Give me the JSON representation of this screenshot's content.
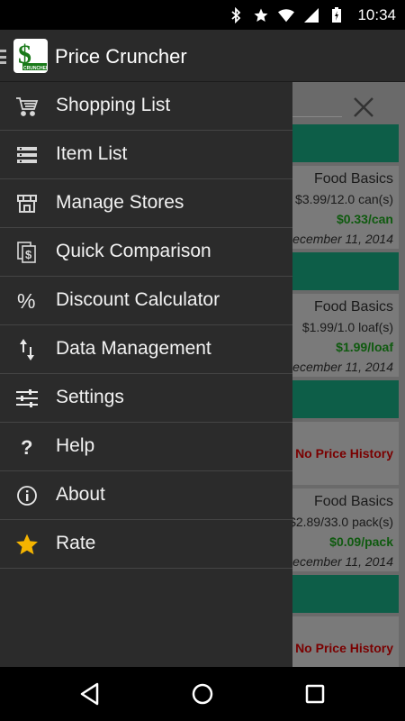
{
  "status_bar": {
    "time": "10:34",
    "icons": [
      "bluetooth-icon",
      "star-icon",
      "wifi-icon",
      "battery-icon"
    ]
  },
  "app_bar": {
    "title": "Price Cruncher",
    "logo_text": "CRUNCHER"
  },
  "drawer": {
    "items": [
      {
        "label": "Shopping List",
        "icon": "cart-icon"
      },
      {
        "label": "Item List",
        "icon": "list-icon"
      },
      {
        "label": "Manage Stores",
        "icon": "store-icon"
      },
      {
        "label": "Quick Comparison",
        "icon": "compare-icon"
      },
      {
        "label": "Discount Calculator",
        "icon": "percent-icon"
      },
      {
        "label": "Data Management",
        "icon": "sort-arrows-icon"
      },
      {
        "label": "Settings",
        "icon": "sliders-icon"
      },
      {
        "label": "Help",
        "icon": "question-icon"
      },
      {
        "label": "About",
        "icon": "info-icon"
      },
      {
        "label": "Rate",
        "icon": "star-icon"
      }
    ]
  },
  "background_list": {
    "cards": [
      {
        "store": "Food Basics",
        "qty": "$3.99/12.0 can(s)",
        "unit_price": "$0.33/can",
        "date": "December 11, 2014"
      },
      {
        "store": "Food Basics",
        "qty": "$1.99/1.0 loaf(s)",
        "unit_price": "$1.99/loaf",
        "date": "December 11, 2014"
      },
      {
        "no_history": "No Price History"
      },
      {
        "store": "Food Basics",
        "qty": "$2.89/33.0 pack(s)",
        "unit_price": "$0.09/pack",
        "date": "December 11, 2014"
      },
      {
        "no_history": "No Price History"
      }
    ]
  },
  "colors": {
    "drawer_bg": "#2b2b2b",
    "accent_green": "#0d5e48",
    "star_yellow": "#f5b400"
  }
}
